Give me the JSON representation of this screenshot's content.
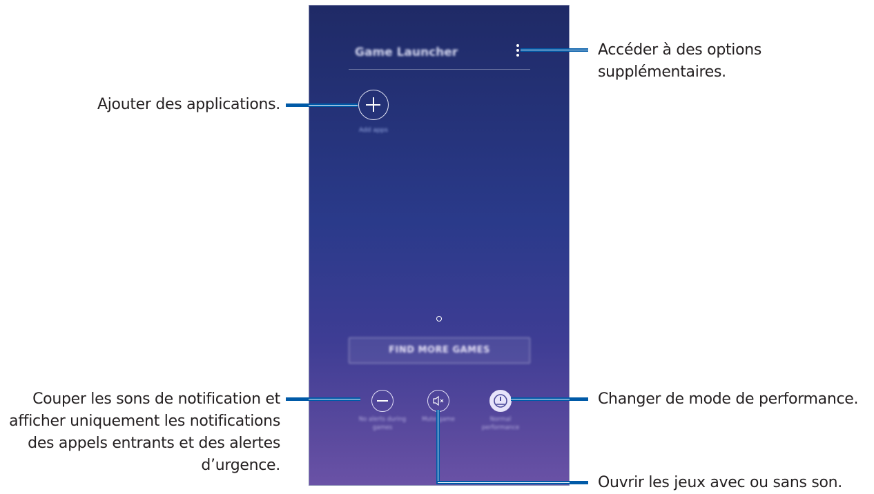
{
  "phone": {
    "app_title": "Game Launcher",
    "add_apps_label": "Add apps",
    "find_more_games": "FIND MORE GAMES",
    "tools": [
      {
        "label": "No alerts during games",
        "icon": "minus-circle-icon"
      },
      {
        "label": "Mute game",
        "icon": "speaker-mute-icon"
      },
      {
        "label": "Normal performance",
        "icon": "speedometer-icon"
      }
    ]
  },
  "callouts": {
    "more_options": "Accéder à des options supplémentaires.",
    "add_apps": "Ajouter des applications.",
    "no_alerts": "Couper les sons de notification et afficher uniquement les notifications des appels entrants et des alertes d’urgence.",
    "performance": "Changer de mode de performance.",
    "mute": "Ouvrir les jeux avec ou sans son."
  },
  "colors": {
    "callout_line": "#005aa7",
    "screen_top": "#1f2a66",
    "screen_bottom": "#6a52a6"
  }
}
